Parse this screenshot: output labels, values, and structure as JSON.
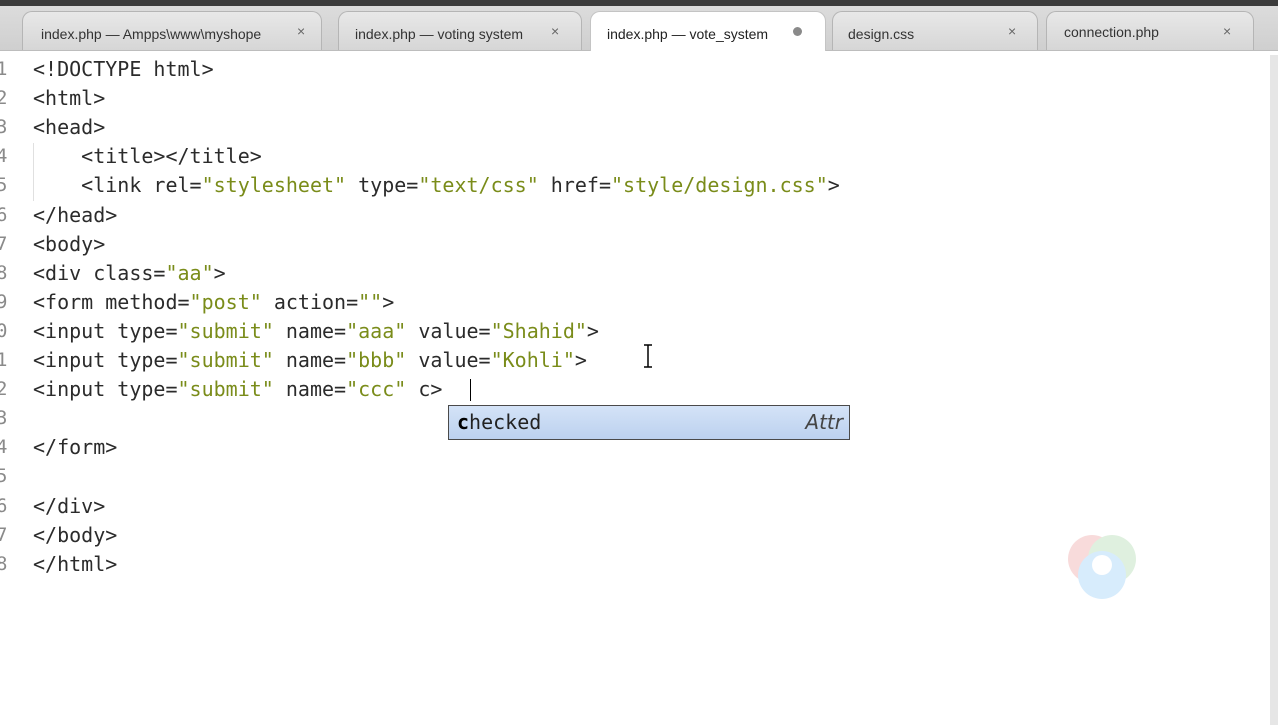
{
  "tabs": [
    {
      "label": "index.php — Ampps\\www\\myshope",
      "close": "×",
      "active": false
    },
    {
      "label": "index.php — voting system",
      "close": "×",
      "active": false
    },
    {
      "label": "index.php — vote_system",
      "close": "●",
      "active": true,
      "modified": true
    },
    {
      "label": "design.css",
      "close": "×",
      "active": false
    },
    {
      "label": "connection.php",
      "close": "×",
      "active": false
    }
  ],
  "gutter": [
    "1",
    "2",
    "3",
    "4",
    "5",
    "6",
    "7",
    "8",
    "9",
    "0",
    "1",
    "2",
    "3",
    "4",
    "5",
    "6",
    "7",
    "8"
  ],
  "code_lines": [
    [
      {
        "t": "<!DOCTYPE html>",
        "c": "t"
      }
    ],
    [
      {
        "t": "<html>",
        "c": "t"
      }
    ],
    [
      {
        "t": "<head>",
        "c": "t"
      }
    ],
    [
      {
        "t": "    <title></title>",
        "c": "t"
      }
    ],
    [
      {
        "t": "    <link rel=",
        "c": "t"
      },
      {
        "t": "\"stylesheet\"",
        "c": "s"
      },
      {
        "t": " type=",
        "c": "t"
      },
      {
        "t": "\"text/css\"",
        "c": "s"
      },
      {
        "t": " href=",
        "c": "t"
      },
      {
        "t": "\"style/design.css\"",
        "c": "s"
      },
      {
        "t": ">",
        "c": "t"
      }
    ],
    [
      {
        "t": "</head>",
        "c": "t"
      }
    ],
    [
      {
        "t": "<body>",
        "c": "t"
      }
    ],
    [
      {
        "t": "<div class=",
        "c": "t"
      },
      {
        "t": "\"aa\"",
        "c": "s"
      },
      {
        "t": ">",
        "c": "t"
      }
    ],
    [
      {
        "t": "<form method=",
        "c": "t"
      },
      {
        "t": "\"post\"",
        "c": "s"
      },
      {
        "t": " action=",
        "c": "t"
      },
      {
        "t": "\"\"",
        "c": "s"
      },
      {
        "t": ">",
        "c": "t"
      }
    ],
    [
      {
        "t": "<input type=",
        "c": "t"
      },
      {
        "t": "\"submit\"",
        "c": "s"
      },
      {
        "t": " name=",
        "c": "t"
      },
      {
        "t": "\"aaa\"",
        "c": "s"
      },
      {
        "t": " value=",
        "c": "t"
      },
      {
        "t": "\"Shahid\"",
        "c": "s"
      },
      {
        "t": ">",
        "c": "t"
      }
    ],
    [
      {
        "t": "<input type=",
        "c": "t"
      },
      {
        "t": "\"submit\"",
        "c": "s"
      },
      {
        "t": " name=",
        "c": "t"
      },
      {
        "t": "\"bbb\"",
        "c": "s"
      },
      {
        "t": " value=",
        "c": "t"
      },
      {
        "t": "\"Kohli\"",
        "c": "s"
      },
      {
        "t": ">",
        "c": "t"
      }
    ],
    [
      {
        "t": "<input type=",
        "c": "t"
      },
      {
        "t": "\"submit\"",
        "c": "s"
      },
      {
        "t": " name=",
        "c": "t"
      },
      {
        "t": "\"ccc\"",
        "c": "s"
      },
      {
        "t": " c>",
        "c": "t"
      }
    ],
    [
      {
        "t": "",
        "c": "t"
      }
    ],
    [
      {
        "t": "</form>",
        "c": "t"
      }
    ],
    [
      {
        "t": "",
        "c": "t"
      }
    ],
    [
      {
        "t": "</div>",
        "c": "t"
      }
    ],
    [
      {
        "t": "</body>",
        "c": "t"
      }
    ],
    [
      {
        "t": "</html>",
        "c": "t"
      }
    ]
  ],
  "autocomplete": {
    "typed": "c",
    "rest": "hecked",
    "kind": "Attr"
  },
  "colors": {
    "string": "#7a8c1a",
    "text": "#2b2b2b",
    "popup": "#c8daf3"
  }
}
